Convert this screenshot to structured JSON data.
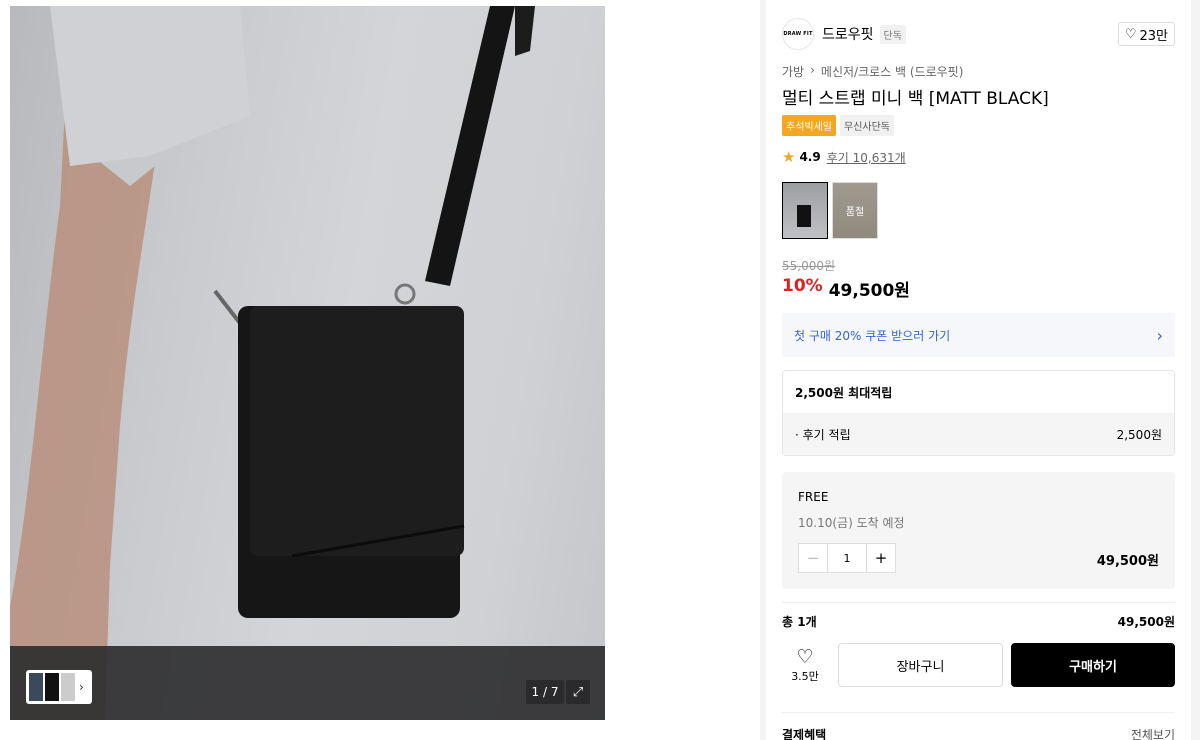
{
  "gallery": {
    "pager": "1 / 7",
    "expand_icon": "expand-icon",
    "thumb_chevron": "›"
  },
  "brand": {
    "logo_text": "DRAW FIT",
    "name": "드로우핏",
    "badge": "단독",
    "likes": "23만"
  },
  "breadcrumb": {
    "category": "가방",
    "separator": "›",
    "subcategory": "메신저/크로스 백 (드로우핏)"
  },
  "product": {
    "title": "멀티 스트랩 미니 백 [MATT BLACK]",
    "tags": [
      "추석빅세일",
      "무신사단독"
    ],
    "rating": "4.9",
    "reviews": "후기 10,631개",
    "option_soldout": "품절",
    "original_price": "55,000원",
    "discount": "10%",
    "price": "49,500원"
  },
  "coupon": {
    "text": "첫 구매 20% 쿠폰 받으러 가기",
    "arrow": "›"
  },
  "points": {
    "title": "2,500원 최대적립",
    "row_label": "· 후기 적립",
    "row_value": "2,500원"
  },
  "selected_option": {
    "name": "FREE",
    "arrival": "10.10(금) 도착 예정",
    "minus": "−",
    "quantity": "1",
    "plus": "+",
    "subtotal": "49,500원"
  },
  "total": {
    "label": "총 1개",
    "amount": "49,500원"
  },
  "actions": {
    "like_count": "3.5만",
    "cart": "장바구니",
    "buy": "구매하기"
  },
  "benefit": {
    "label": "결제혜택",
    "more": "전체보기"
  },
  "colors": {
    "accent_red": "#e02020",
    "coupon_blue": "#3563d8",
    "sale_tag": "#f5a623",
    "buy_button": "#000000"
  }
}
